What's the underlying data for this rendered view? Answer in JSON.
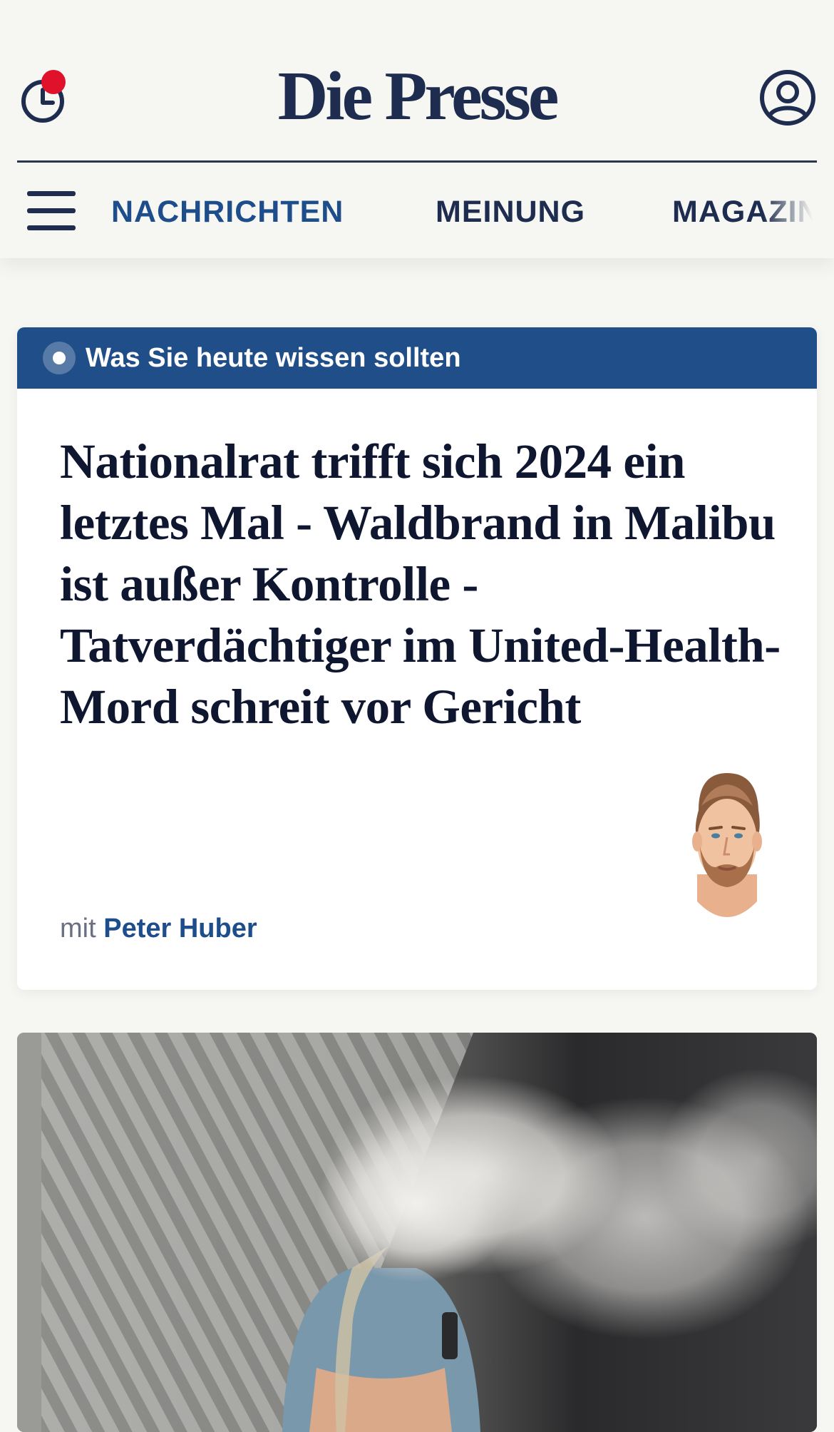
{
  "header": {
    "logo_text": "Die Presse",
    "history_icon": "clock-history-icon",
    "account_icon": "user-account-icon",
    "notification_color": "#e0112b"
  },
  "nav": {
    "menu_icon": "hamburger-menu-icon",
    "items": [
      {
        "label": "NACHRICHTEN",
        "active": true
      },
      {
        "label": "MEINUNG",
        "active": false
      },
      {
        "label": "MAGAZIN",
        "active": false
      }
    ]
  },
  "briefing": {
    "label": "Was Sie heute wissen sollten",
    "headline": "Nationalrat trifft sich 2024 ein letztes Mal - Waldbrand in Malibu ist außer Kontrolle - Tatverdächtiger im United-Health-Mord schreit vor Gericht",
    "byline_prefix": "mit",
    "byline_author": "Peter Huber",
    "accent_color": "#1f4e89"
  },
  "colors": {
    "brand_navy": "#1e2d4f",
    "link_blue": "#1e4d8b",
    "page_background": "#f6f6f2"
  }
}
